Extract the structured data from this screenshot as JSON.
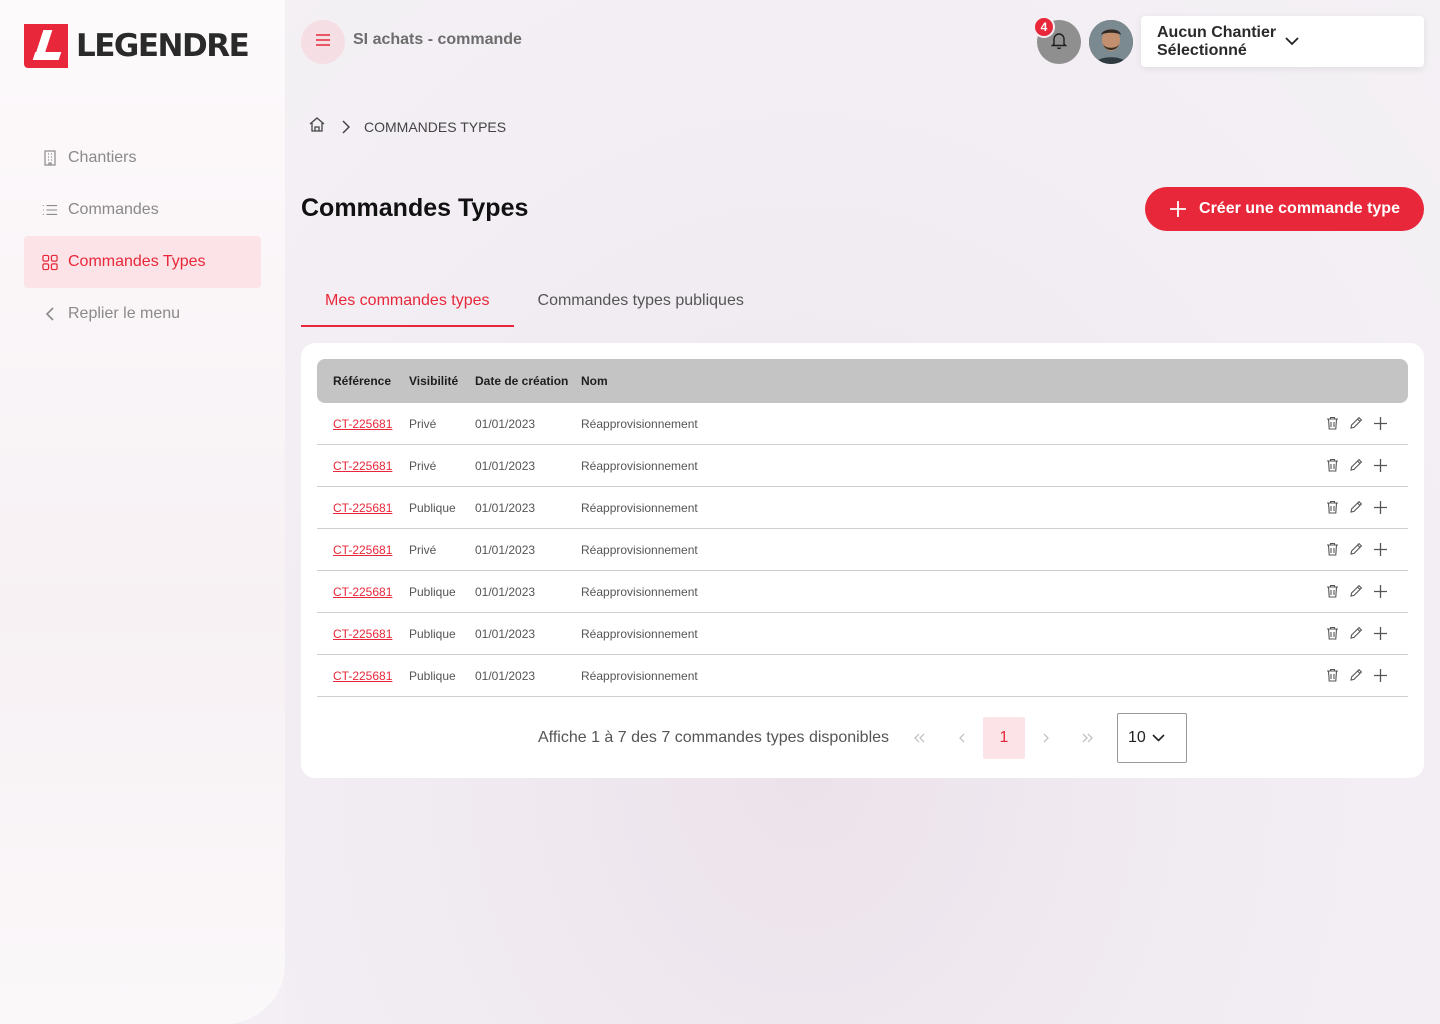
{
  "brand": {
    "name": "LEGENDRE",
    "accent": "#e8283a"
  },
  "sidebar": {
    "items": [
      {
        "label": "Chantiers",
        "icon": "building-icon"
      },
      {
        "label": "Commandes",
        "icon": "list-icon"
      },
      {
        "label": "Commandes Types",
        "icon": "grid-icon",
        "active": true
      },
      {
        "label": "Replier le menu",
        "icon": "chevron-left-icon"
      }
    ]
  },
  "header": {
    "app_title": "SI achats - commande",
    "notification_count": "4",
    "site_select": "Aucun Chantier Sélectionné"
  },
  "breadcrumb": {
    "current": "COMMANDES TYPES"
  },
  "page": {
    "title": "Commandes Types",
    "create_button": "Créer une commande type"
  },
  "tabs": [
    {
      "label": "Mes commandes types",
      "active": true
    },
    {
      "label": "Commandes types publiques"
    }
  ],
  "table": {
    "columns": [
      "Référence",
      "Visibilité",
      "Date de création",
      "Nom"
    ],
    "rows": [
      {
        "ref": "CT-225681",
        "visibility": "Privé",
        "date": "01/01/2023",
        "name": "Réapprovisionnement"
      },
      {
        "ref": "CT-225681",
        "visibility": "Privé",
        "date": "01/01/2023",
        "name": "Réapprovisionnement"
      },
      {
        "ref": "CT-225681",
        "visibility": "Publique",
        "date": "01/01/2023",
        "name": "Réapprovisionnement"
      },
      {
        "ref": "CT-225681",
        "visibility": "Privé",
        "date": "01/01/2023",
        "name": "Réapprovisionnement"
      },
      {
        "ref": "CT-225681",
        "visibility": "Publique",
        "date": "01/01/2023",
        "name": "Réapprovisionnement"
      },
      {
        "ref": "CT-225681",
        "visibility": "Publique",
        "date": "01/01/2023",
        "name": "Réapprovisionnement"
      },
      {
        "ref": "CT-225681",
        "visibility": "Publique",
        "date": "01/01/2023",
        "name": "Réapprovisionnement"
      }
    ]
  },
  "pagination": {
    "info": "Affiche 1 à 7 des 7 commandes types disponibles",
    "current_page": "1",
    "per_page": "10"
  }
}
